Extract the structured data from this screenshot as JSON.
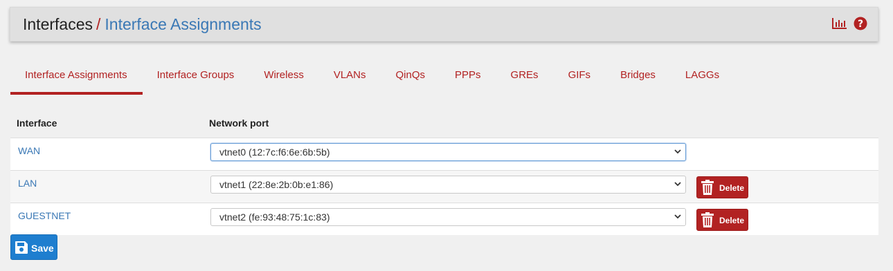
{
  "header": {
    "breadcrumb_root": "Interfaces",
    "breadcrumb_sep": "/",
    "breadcrumb_current": "Interface Assignments",
    "icons": [
      "bar-chart-icon",
      "help-icon"
    ]
  },
  "tabs": [
    {
      "label": "Interface Assignments",
      "active": true
    },
    {
      "label": "Interface Groups",
      "active": false
    },
    {
      "label": "Wireless",
      "active": false
    },
    {
      "label": "VLANs",
      "active": false
    },
    {
      "label": "QinQs",
      "active": false
    },
    {
      "label": "PPPs",
      "active": false
    },
    {
      "label": "GREs",
      "active": false
    },
    {
      "label": "GIFs",
      "active": false
    },
    {
      "label": "Bridges",
      "active": false
    },
    {
      "label": "LAGGs",
      "active": false
    }
  ],
  "table": {
    "columns": [
      "Interface",
      "Network port"
    ],
    "rows": [
      {
        "interface": "WAN",
        "port": "vtnet0 (12:7c:f6:6e:6b:5b)",
        "delete": false
      },
      {
        "interface": "LAN",
        "port": "vtnet1 (22:8e:2b:0b:e1:86)",
        "delete": true,
        "delete_label": "Delete"
      },
      {
        "interface": "GUESTNET",
        "port": "vtnet2 (fe:93:48:75:1c:83)",
        "delete": true,
        "delete_label": "Delete"
      }
    ]
  },
  "save_label": "Save",
  "colors": {
    "accent": "#b22222",
    "link": "#3a78b5",
    "save": "#1e7ecf",
    "header_bg": "#e0e0e0"
  }
}
